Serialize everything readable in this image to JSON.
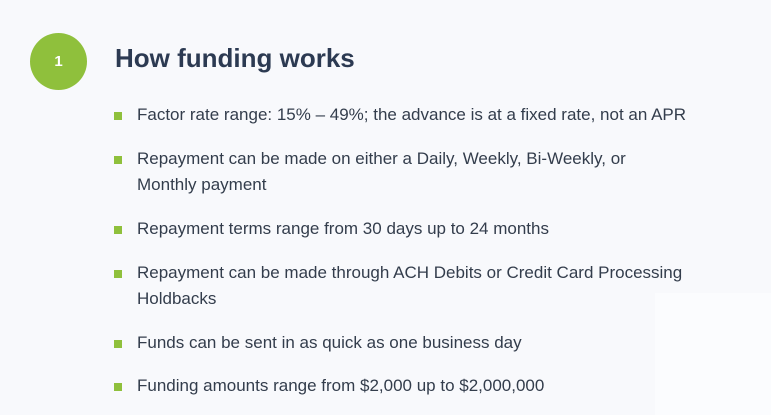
{
  "step": {
    "number": "1",
    "title": "How funding works"
  },
  "features": [
    "Factor rate range: 15% – 49%; the advance is at a fixed rate, not an APR",
    "Repayment can be made on either a Daily, Weekly, Bi-Weekly, or Monthly payment",
    "Repayment terms range from 30 days up to 24 months",
    "Repayment can be made through ACH Debits or Credit Card Processing Holdbacks",
    "Funds can be sent in as quick as one business day",
    "Funding amounts range from $2,000 up to $2,000,000"
  ],
  "colors": {
    "accent": "#8fc03c",
    "title": "#2c3a52",
    "text": "#333d4c",
    "background": "#f8f9fc"
  }
}
